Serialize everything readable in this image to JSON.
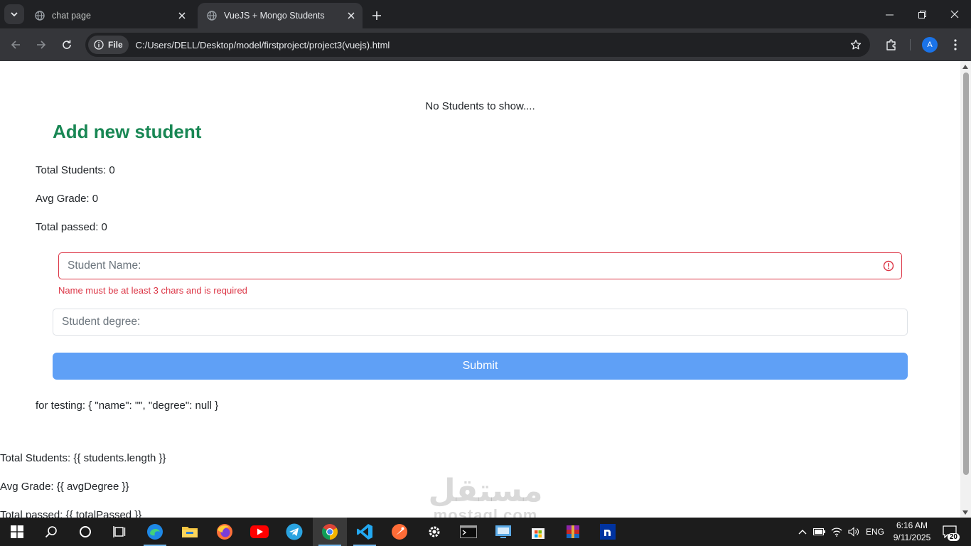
{
  "browser": {
    "tabs": [
      {
        "title": "chat page",
        "active": false
      },
      {
        "title": "VueJS + Mongo Students",
        "active": true
      }
    ],
    "address": {
      "scheme_chip": "File",
      "url": "C:/Users/DELL/Desktop/model/firstproject/project3(vuejs).html"
    },
    "profile_initial": "A"
  },
  "page": {
    "empty_message": "No Students to show....",
    "heading": "Add new student",
    "stats": {
      "total_students": "Total Students: 0",
      "avg_grade": "Avg Grade: 0",
      "total_passed": "Total passed: 0"
    },
    "form": {
      "name_placeholder": "Student Name:",
      "name_error": "Name must be at least 3 chars and is required",
      "degree_placeholder": "Student degree:",
      "submit_label": "Submit"
    },
    "testing_line": "for testing: { \"name\": \"\", \"degree\": null }",
    "raw_template": {
      "total_students": "Total Students: {{ students.length }}",
      "avg_grade": "Avg Grade: {{ avgDegree }}",
      "total_passed": "Total passed: {{ totalPassed }}"
    },
    "colors": {
      "heading": "#198754",
      "error": "#dc3545",
      "submit": "#5fa0f6"
    }
  },
  "watermark": {
    "arabic": "مستقل",
    "latin": "mostaql.com"
  },
  "taskbar": {
    "apps": [
      "start-icon",
      "search-icon",
      "cortana-icon",
      "task-view-icon",
      "edge-icon",
      "file-explorer-icon",
      "firefox-icon",
      "youtube-icon",
      "telegram-icon",
      "chrome-icon",
      "vscode-icon",
      "postman-icon",
      "settings-icon",
      "terminal-icon",
      "network-app-icon",
      "store-icon",
      "winrar-icon",
      "notion-icon"
    ],
    "language": "ENG",
    "time": "6:16 AM",
    "date": "9/11/2025",
    "notification_count": "20"
  }
}
